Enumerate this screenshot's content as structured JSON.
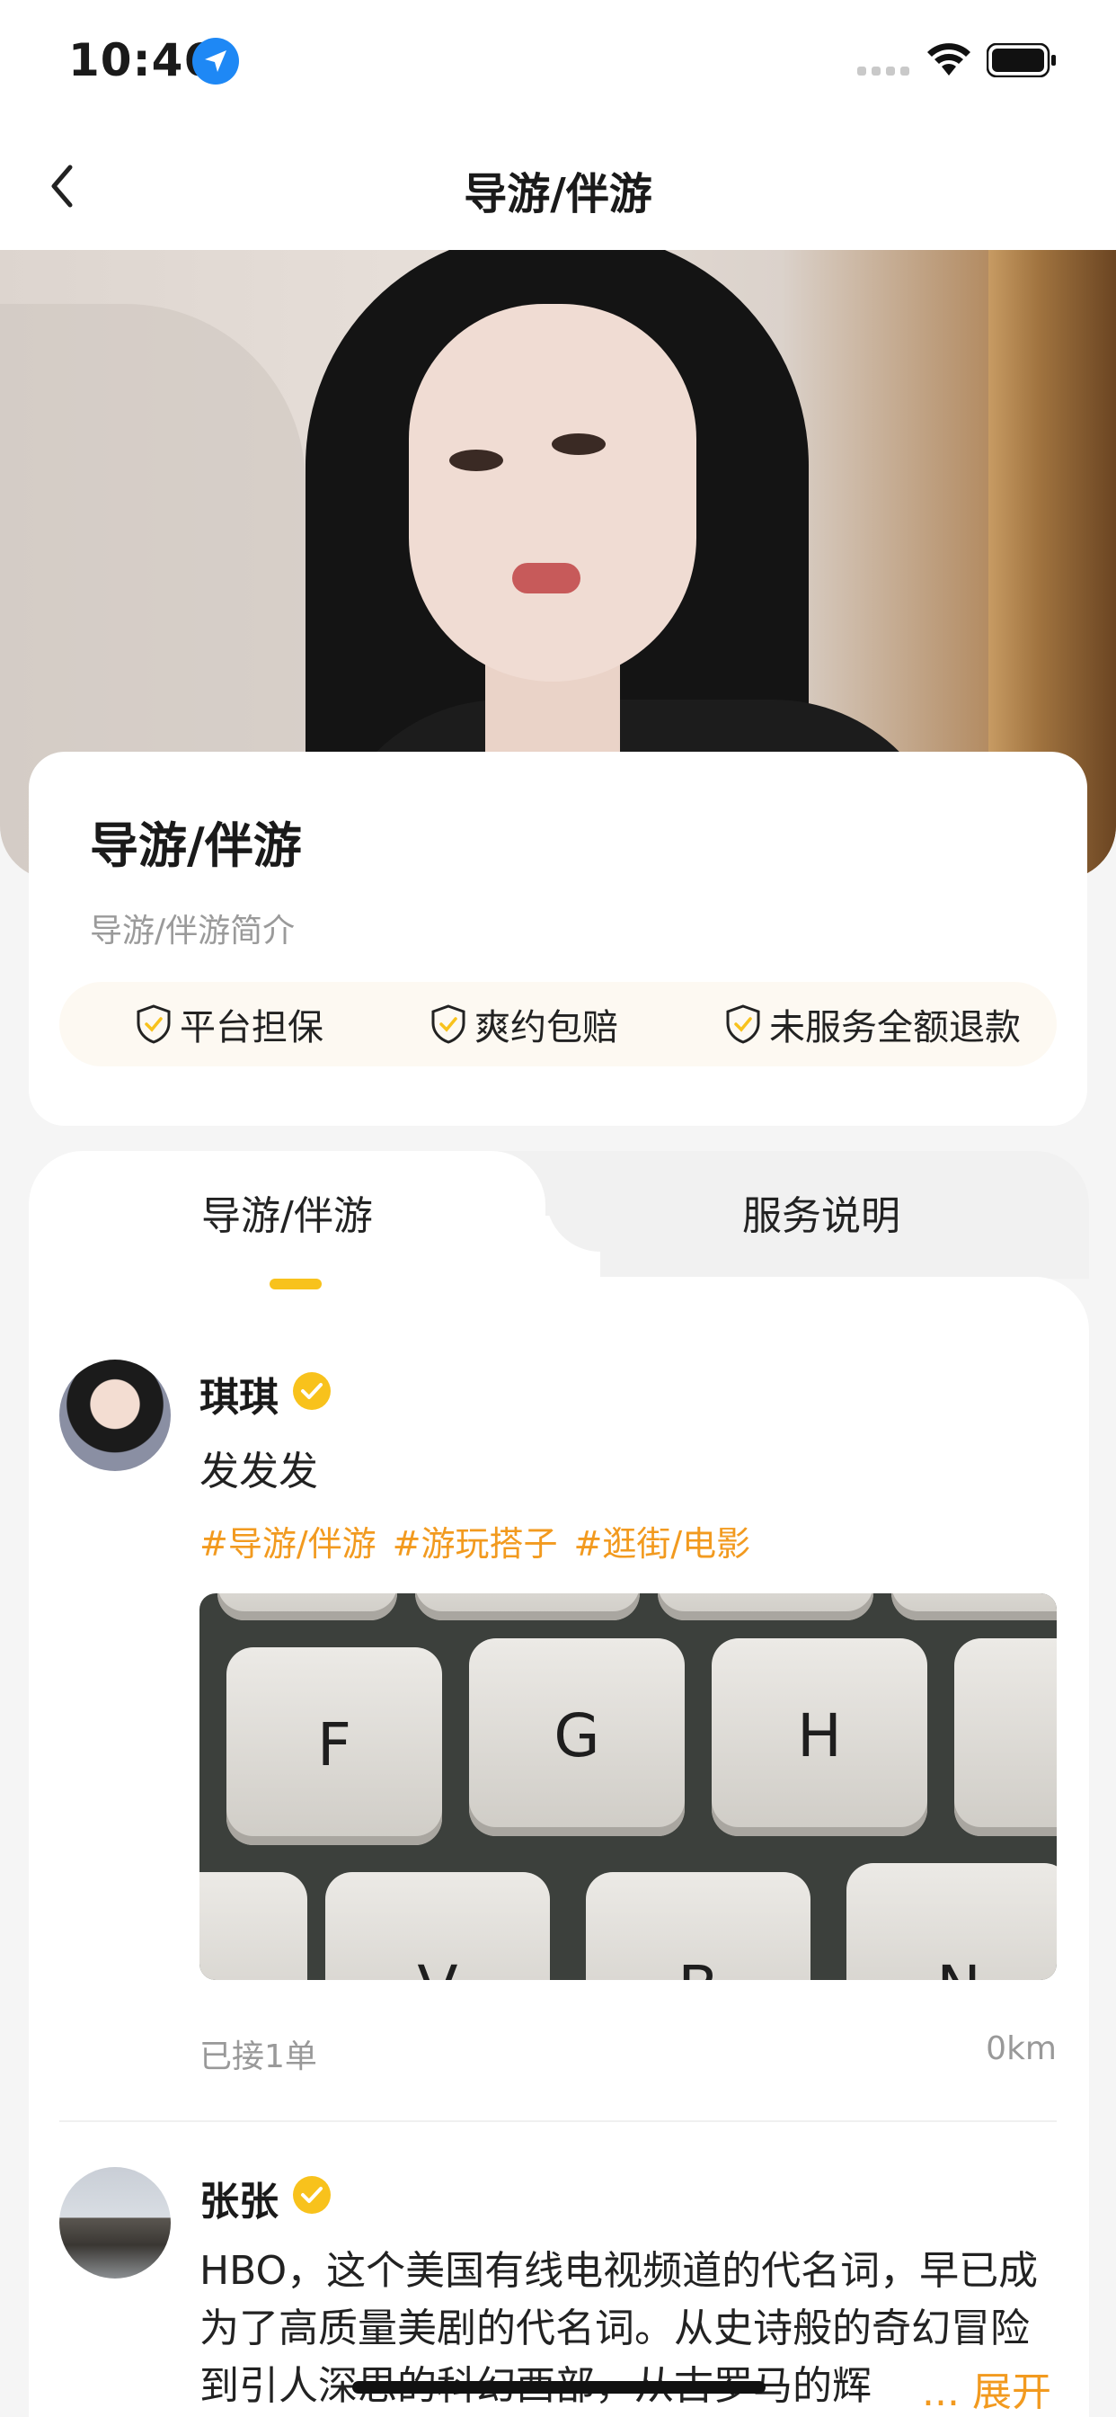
{
  "status_bar": {
    "time": "10:46"
  },
  "nav": {
    "title": "导游/伴游"
  },
  "info_card": {
    "title": "导游/伴游",
    "description": "导游/伴游简介",
    "guarantees": [
      "平台担保",
      "爽约包赔",
      "未服务全额退款"
    ]
  },
  "tabs": [
    {
      "label": "导游/伴游",
      "active": true
    },
    {
      "label": "服务说明",
      "active": false
    }
  ],
  "posts": [
    {
      "username": "琪琪",
      "text": "发发发",
      "tags": [
        "#导游/伴游",
        "#游玩搭子",
        "#逛街/电影"
      ],
      "image_keys": [
        "F",
        "G",
        "H",
        "V",
        "B",
        "N"
      ],
      "orders": "已接1单",
      "distance": "0km"
    },
    {
      "username": "张张",
      "text": "HBO，这个美国有线电视频道的代名词，早已成为了高质量美剧的代名词。从史诗般的奇幻冒险到引人深思的科幻西部，从古罗马的辉",
      "expand_label": "... 展开"
    }
  ],
  "colors": {
    "accent": "#f8c21c",
    "tag": "#f29a1f",
    "verified": "#f8c21c"
  }
}
